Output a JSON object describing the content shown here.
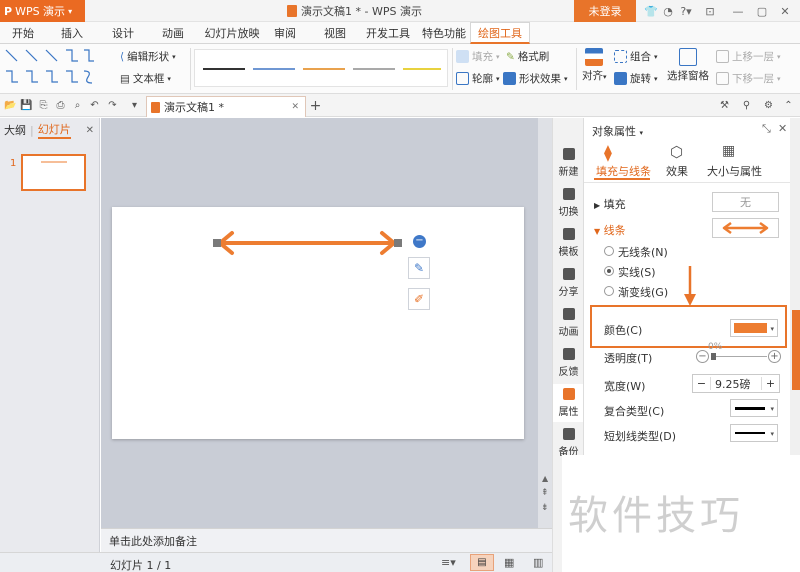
{
  "app": {
    "name": "WPS 演示",
    "doc_title": "演示文稿1 * - WPS 演示",
    "login_label": "未登录"
  },
  "tabs": [
    "开始",
    "插入",
    "设计",
    "动画",
    "幻灯片放映",
    "审阅",
    "视图",
    "开发工具",
    "特色功能",
    "绘图工具"
  ],
  "active_tab": "绘图工具",
  "ribbon": {
    "edit_shape": "编辑形状",
    "textbox": "文本框",
    "fill": "填充",
    "format_painter": "格式刷",
    "outline": "轮廓",
    "shape_effects": "形状效果",
    "align": "对齐",
    "group": "组合",
    "rotate": "旋转",
    "selection_pane": "选择窗格",
    "bring_forward": "上移一层",
    "send_backward": "下移一层"
  },
  "document_tab": "演示文稿1 *",
  "left_panel": {
    "tab_outline": "大纲",
    "tab_slides": "幻灯片",
    "slide_number": "1"
  },
  "notes_placeholder": "单击此处添加备注",
  "status": {
    "slide_indicator": "幻灯片 1 / 1"
  },
  "side_strip": [
    "新建",
    "切换",
    "模板",
    "分享",
    "动画",
    "反馈",
    "属性",
    "备份"
  ],
  "properties": {
    "panel_title": "对象属性",
    "tabs": [
      "填充与线条",
      "效果",
      "大小与属性"
    ],
    "fill_section": "填充",
    "fill_value": "无",
    "line_section": "线条",
    "line_options": [
      "无线条(N)",
      "实线(S)",
      "渐变线(G)"
    ],
    "color_label": "颜色(C)",
    "transparency_label": "透明度(T)",
    "transparency_value": "0%",
    "width_label": "宽度(W)",
    "width_value": "9.25磅",
    "compound_label": "复合类型(C)",
    "dash_label": "短划线类型(D)"
  },
  "colors": {
    "accent": "#e8742a",
    "line_color": "#ed7d31"
  },
  "watermark": "软件技巧"
}
